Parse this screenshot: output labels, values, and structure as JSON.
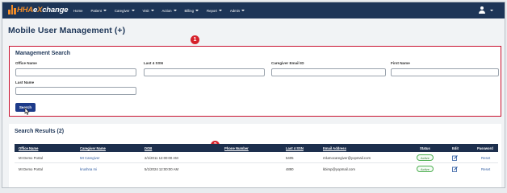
{
  "nav": {
    "logo_hha": "HHA",
    "logo_rest": "e",
    "logo_x": "X",
    "logo_change": "change",
    "items": [
      {
        "label": "Home",
        "caret": false
      },
      {
        "label": "Patient",
        "caret": true
      },
      {
        "label": "Caregiver",
        "caret": true
      },
      {
        "label": "Visit",
        "caret": true
      },
      {
        "label": "Action",
        "caret": true
      },
      {
        "label": "Billing",
        "caret": true
      },
      {
        "label": "Report",
        "caret": true
      },
      {
        "label": "Admin",
        "caret": true
      }
    ]
  },
  "page": {
    "title": "Mobile User Management (+)"
  },
  "callouts": {
    "one": "1",
    "two": "2"
  },
  "search": {
    "title": "Management Search",
    "office_name_label": "Office Name",
    "last4_label": "Last 4 SSN",
    "email_label": "Caregiver Email ID",
    "first_name_label": "First Name",
    "last_name_label": "Last Name",
    "button_label": "Search"
  },
  "results": {
    "title": "Search Results (2)",
    "columns": [
      "Office Name",
      "Caregiver Name",
      "DOB",
      "Phone Number",
      "Last 4 SSN",
      "Email Address",
      "Status",
      "Edit",
      "Password"
    ],
    "rows": [
      {
        "office": "MI Demo Portal",
        "caregiver": "MI Caregiver",
        "dob": "2/1/2011 12:00:00 AM",
        "phone": "",
        "ssn": "5405",
        "email": "mlumocaregiver@yopmail.com",
        "status": "Active",
        "password": "Reset"
      },
      {
        "office": "MI Demo Portal",
        "caregiver": "krushna mi",
        "dob": "5/1/2024 12:00:00 AM",
        "phone": "",
        "ssn": "4890",
        "email": "kbimp@yopmail.com",
        "status": "Active",
        "password": "Reset"
      }
    ]
  },
  "colors": {
    "nav_bg": "#1d3557",
    "brand_orange": "#f28c28",
    "callout_red": "#d6202a",
    "search_border": "#c8102e",
    "button_blue": "#1d3b8a",
    "table_header": "#1d2f4d",
    "status_green": "#4caf50"
  },
  "icons": [
    "user-icon",
    "edit-icon",
    "cursor-icon"
  ]
}
